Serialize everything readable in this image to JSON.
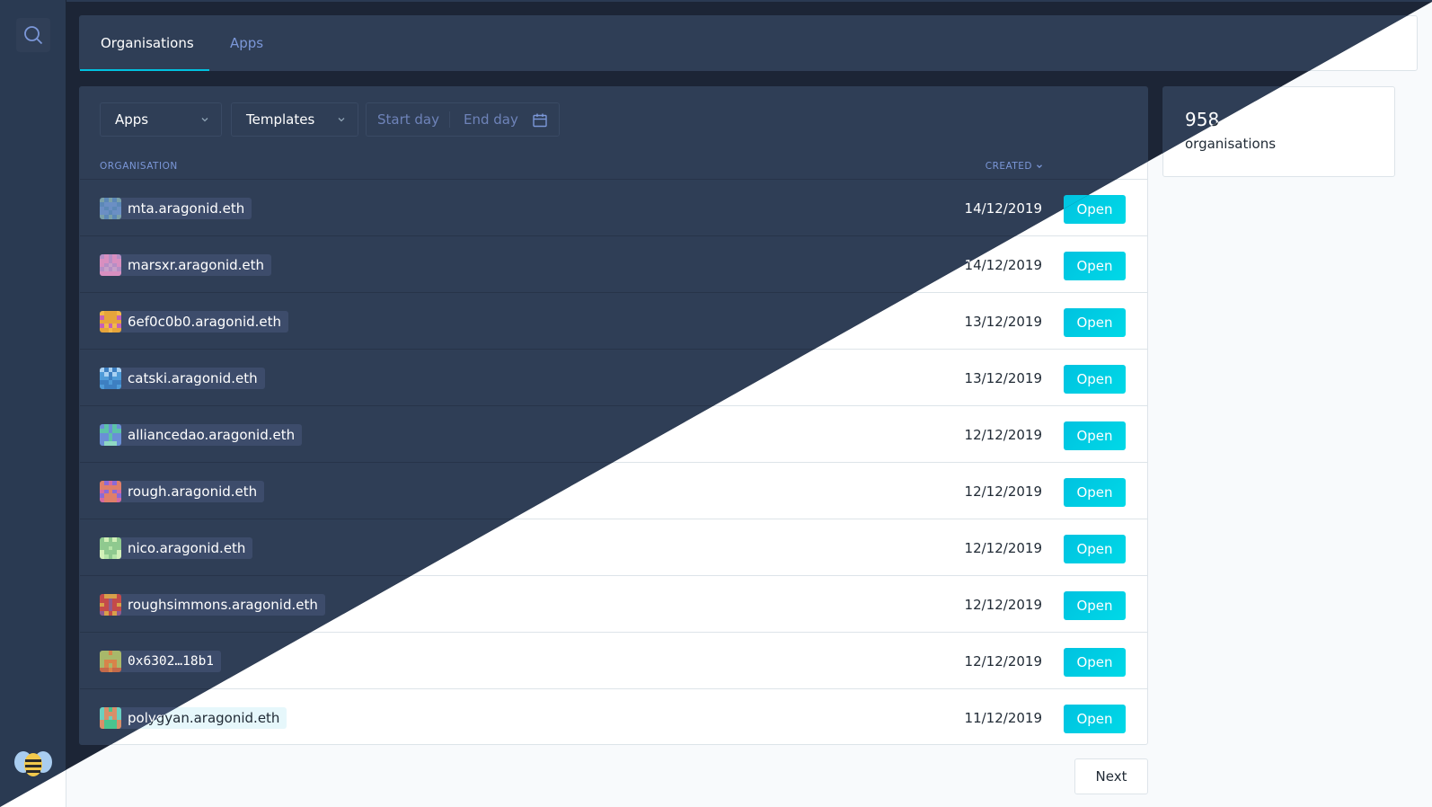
{
  "nav": {
    "tabs": [
      {
        "label": "Organisations",
        "active": true
      },
      {
        "label": "Apps",
        "active": false
      }
    ]
  },
  "filters": {
    "apps_label": "Apps",
    "templates_label": "Templates",
    "start_day_placeholder": "Start day",
    "end_day_placeholder": "End day"
  },
  "table": {
    "col_organisation": "ORGANISATION",
    "col_created": "CREATED",
    "rows": [
      {
        "name": "mta.aragonid.eth",
        "created": "14/12/2019",
        "action": "Open",
        "colors": [
          "#6b8fc4",
          "#7aa0a8",
          "#5c88b7"
        ]
      },
      {
        "name": "marsxr.aragonid.eth",
        "created": "14/12/2019",
        "action": "Open",
        "colors": [
          "#d88fc0",
          "#c8a0c8",
          "#b68ec5"
        ]
      },
      {
        "name": "6ef0c0b0.aragonid.eth",
        "created": "13/12/2019",
        "action": "Open",
        "colors": [
          "#e6a53b",
          "#c561b8",
          "#f2b84a"
        ]
      },
      {
        "name": "catski.aragonid.eth",
        "created": "13/12/2019",
        "action": "Open",
        "colors": [
          "#4f9bd8",
          "#a9d1f2",
          "#3d7fc1"
        ]
      },
      {
        "name": "alliancedao.aragonid.eth",
        "created": "12/12/2019",
        "action": "Open",
        "colors": [
          "#5cc2a8",
          "#6a8fd6",
          "#8fd8c4"
        ]
      },
      {
        "name": "rough.aragonid.eth",
        "created": "12/12/2019",
        "action": "Open",
        "colors": [
          "#d46aa0",
          "#8b6ad6",
          "#e07f6a"
        ]
      },
      {
        "name": "nico.aragonid.eth",
        "created": "12/12/2019",
        "action": "Open",
        "colors": [
          "#b5e4a8",
          "#8fc98f",
          "#d2f0b8"
        ]
      },
      {
        "name": "roughsimmons.aragonid.eth",
        "created": "12/12/2019",
        "action": "Open",
        "colors": [
          "#c44a4a",
          "#d8a04a",
          "#8f5a8f"
        ]
      },
      {
        "name": "0x6302…18b1",
        "created": "12/12/2019",
        "action": "Open",
        "mono": true,
        "colors": [
          "#d8834a",
          "#a8b86a",
          "#c46a4a"
        ]
      },
      {
        "name": "polygyan.aragonid.eth",
        "created": "11/12/2019",
        "action": "Open",
        "colors": [
          "#4ac48f",
          "#d88f6a",
          "#6ad0c0"
        ]
      }
    ]
  },
  "summary": {
    "count": "958",
    "label": "organisations"
  },
  "pagination": {
    "next_label": "Next"
  },
  "theme_colors": {
    "accent": "#00c2e0",
    "dark_bg": "#1c2536",
    "dark_panel": "#2f3e56",
    "light_bg": "#f8fafc"
  },
  "icons": [
    "search-icon",
    "aragon-logo",
    "chevron-down-icon",
    "calendar-icon"
  ]
}
